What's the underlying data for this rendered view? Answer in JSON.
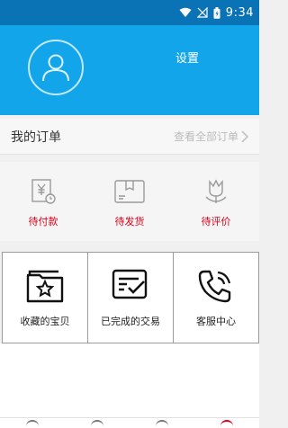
{
  "status_bar": {
    "time": "9:34",
    "icons": [
      "wifi-icon",
      "signal-icon",
      "battery-icon"
    ]
  },
  "header": {
    "settings_label": "设置",
    "avatar_icon": "user-avatar-icon"
  },
  "orders": {
    "title": "我的订单",
    "view_all": "查看全部订单"
  },
  "order_statuses": [
    {
      "label": "待付款",
      "icon": "payment-icon"
    },
    {
      "label": "待发货",
      "icon": "package-icon"
    },
    {
      "label": "待评价",
      "icon": "review-icon"
    }
  ],
  "grid_items": [
    {
      "label": "收藏的宝贝",
      "icon": "favorites-icon"
    },
    {
      "label": "已完成的交易",
      "icon": "completed-trade-icon"
    },
    {
      "label": "客服中心",
      "icon": "phone-icon"
    }
  ],
  "bottom_nav": {
    "icons": [
      "home-icon",
      "community-icon",
      "cart-icon",
      "profile-icon"
    ]
  },
  "colors": {
    "header": "#12a5ea",
    "status_bar": "#0a73b5",
    "accent": "#d9001b"
  }
}
